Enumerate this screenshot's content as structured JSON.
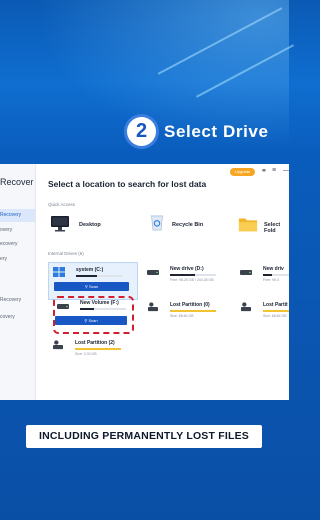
{
  "step": {
    "number": "2",
    "label": "Select  Drive"
  },
  "app": {
    "brand": "Recover",
    "sidebar_items": [
      "Recovery",
      "overy",
      "ecovery",
      "ery",
      "",
      "Recovery",
      "covery"
    ],
    "title": "Select a location to search for lost data",
    "upgrade_label": "Upgrade",
    "quick_access_label": "Quick Access",
    "quick_access": [
      {
        "label": "Desktop",
        "icon": "desktop-monitor-icon"
      },
      {
        "label": "Recycle Bin",
        "icon": "recycle-bin-icon"
      },
      {
        "label": "Select Fold",
        "icon": "folder-icon"
      }
    ],
    "internal_drives_label": "Internal Drives (6)",
    "scan_label": "Scan",
    "drives": [
      {
        "name": "system (C:)",
        "free": "",
        "used_fraction": 0.45,
        "bar_color": "#1f2530",
        "icon": "windows-drive-icon",
        "selected": true,
        "show_scan": true
      },
      {
        "name": "New drive (D:)",
        "free": "Free: 98.25 GB / 244.35 GB",
        "used_fraction": 0.55,
        "bar_color": "#1f2530",
        "icon": "hard-drive-icon"
      },
      {
        "name": "New driv",
        "free": "Free: 99.3",
        "used_fraction": 0.2,
        "bar_color": "#1f2530",
        "icon": "hard-drive-icon"
      },
      {
        "name": "New Volume (F:)",
        "free": "",
        "used_fraction": 0.3,
        "bar_color": "#1f2530",
        "icon": "hard-drive-icon",
        "highlighted": true,
        "show_scan": true
      },
      {
        "name": "Lost Partition (0)",
        "free": "Size: 68.84 GB",
        "used_fraction": 1.0,
        "bar_color": "#f2c230",
        "icon": "lost-partition-icon"
      },
      {
        "name": "Lost Partit",
        "free": "Size: 68.84 GB",
        "used_fraction": 1.0,
        "bar_color": "#f2c230",
        "icon": "lost-partition-icon"
      },
      {
        "name": "Lost Partition (2)",
        "free": "Size: 2.00 GB",
        "used_fraction": 1.0,
        "bar_color": "#f2c230",
        "icon": "lost-partition-icon"
      }
    ]
  },
  "caption": "INCLUDING PERMANENTLY LOST FILES"
}
